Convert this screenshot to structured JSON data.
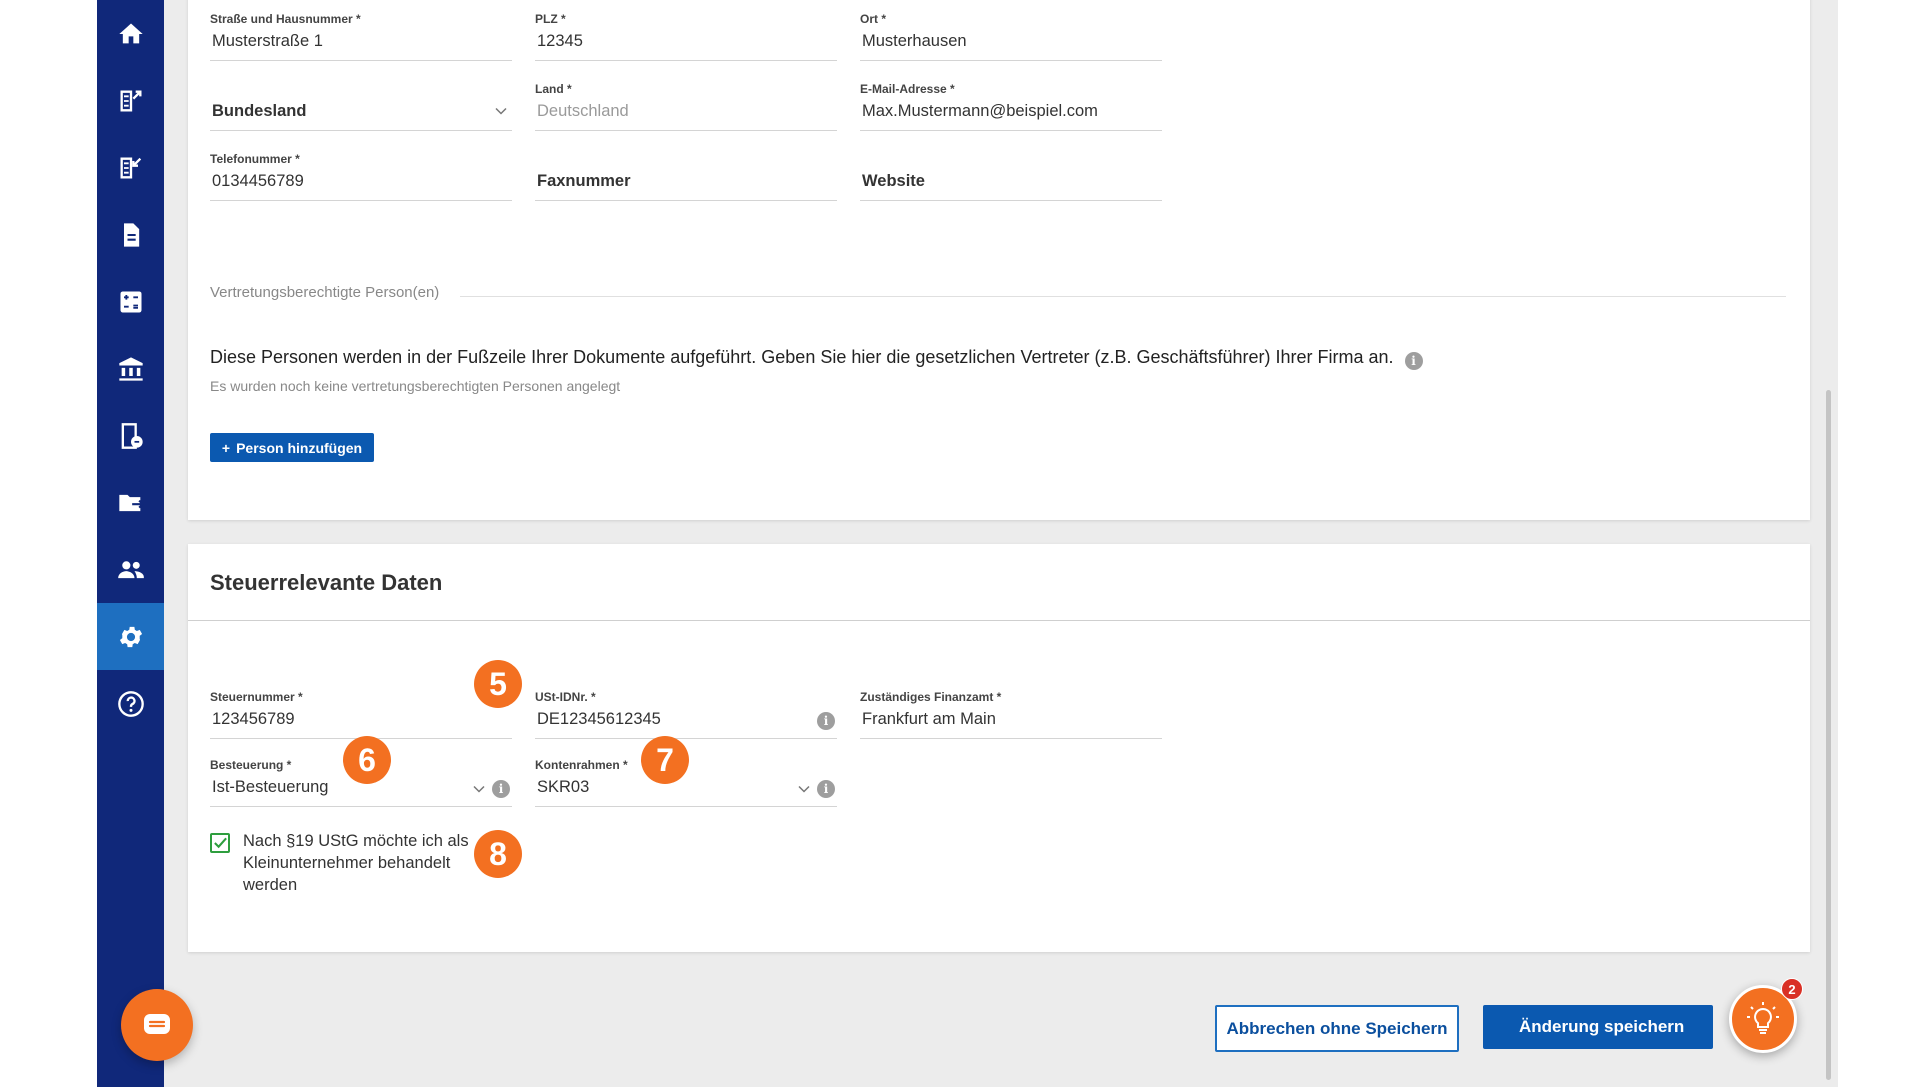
{
  "sidebar": {
    "items": [
      {
        "icon": "home-icon"
      },
      {
        "icon": "outgoing-invoices-icon"
      },
      {
        "icon": "incoming-invoices-icon"
      },
      {
        "icon": "document-icon"
      },
      {
        "icon": "calculator-icon"
      },
      {
        "icon": "bank-icon"
      },
      {
        "icon": "receipt-icon"
      },
      {
        "icon": "folder-export-icon"
      },
      {
        "icon": "contacts-icon"
      },
      {
        "icon": "settings-icon",
        "active": true
      },
      {
        "icon": "help-icon"
      }
    ]
  },
  "address": {
    "street": {
      "label": "Straße und Hausnummer *",
      "value": "Musterstraße 1"
    },
    "zip": {
      "label": "PLZ *",
      "value": "12345"
    },
    "city": {
      "label": "Ort *",
      "value": "Musterhausen"
    },
    "state": {
      "label": "",
      "value": "Bundesland"
    },
    "country": {
      "label": "Land *",
      "value": "Deutschland"
    },
    "email": {
      "label": "E-Mail-Adresse *",
      "value": "Max.Mustermann@beispiel.com"
    },
    "phone": {
      "label": "Telefonummer *",
      "value": "0134456789"
    },
    "fax": {
      "label": "",
      "value": "Faxnummer"
    },
    "website": {
      "label": "",
      "value": "Website"
    }
  },
  "representatives": {
    "section_label": "Vertretungsberechtigte Person(en)",
    "description": "Diese Personen werden in der Fußzeile Ihrer Dokumente aufgeführt. Geben Sie hier die gesetzlichen Vertreter (z.B. Geschäftsführer) Ihrer Firma an.",
    "empty_note": "Es wurden noch keine vertretungsberechtigten Personen angelegt",
    "add_button": "Person hinzufügen",
    "add_prefix": "+"
  },
  "tax": {
    "title": "Steuerrelevante Daten",
    "tax_number": {
      "label": "Steuernummer *",
      "value": "123456789"
    },
    "vat_id": {
      "label": "USt-IDNr. *",
      "value": "DE12345612345"
    },
    "tax_office": {
      "label": "Zuständiges Finanzamt *",
      "value": "Frankfurt am Main"
    },
    "taxation": {
      "label": "Besteuerung *",
      "value": "Ist-Besteuerung"
    },
    "chart_of_accounts": {
      "label": "Kontenrahmen *",
      "value": "SKR03"
    },
    "small_business": {
      "label": "Nach §19 UStG möchte ich als Kleinunternehmer behandelt werden",
      "checked": true
    }
  },
  "badges": [
    "5",
    "6",
    "7",
    "8"
  ],
  "info_glyph": "i",
  "footer": {
    "cancel": "Abbrechen ohne Speichern",
    "save": "Änderung speichern"
  },
  "tips": {
    "count": "2"
  },
  "colors": {
    "sidebar": "#10287a",
    "active": "#1e6fc0",
    "accent": "#f37021",
    "primary": "#0b59b0"
  }
}
